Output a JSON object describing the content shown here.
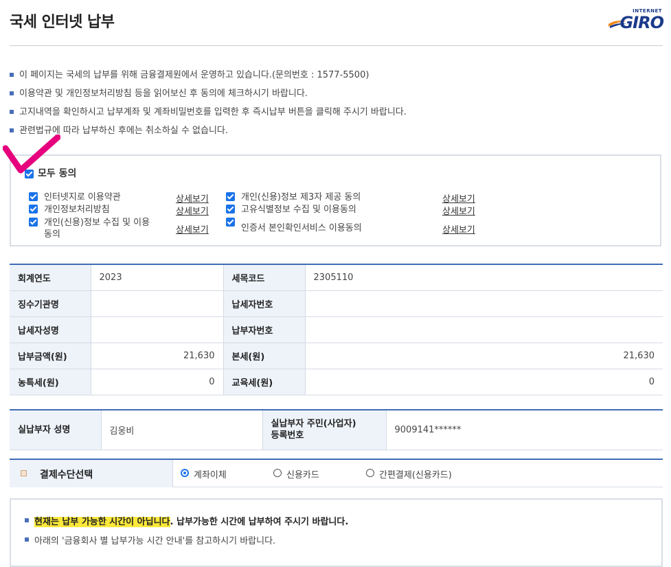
{
  "header": {
    "title": "국세 인터넷 납부",
    "logo_top": "INTERNET",
    "logo_main": "GIRO"
  },
  "notices": [
    "이 페이지는 국세의 납부를 위해 금융결제원에서 운영하고 있습니다.(문의번호 : 1577-5500)",
    "이용약관 및 개인정보처리방침 등을 읽어보신 후 동의에 체크하시기 바랍니다.",
    "고지내역을 확인하시고 납부계좌 및 계좌비밀번호를 입력한 후 즉시납부 버튼을 클릭해 주시기 바랍니다.",
    "관련법규에 따라 납부하신 후에는 취소하실 수 없습니다."
  ],
  "agreement": {
    "all_label": "모두 동의",
    "detail_label": "상세보기",
    "terms": [
      "인터넷지로 이용약관",
      "개인정보처리방침",
      "개인(신용)정보 수집 및 이용",
      "동의",
      "개인(신용)정보 제3자 제공 동의",
      "고유식별정보 수집 및 이용동의",
      "인증서 본인확인서비스 이용동의"
    ]
  },
  "info": {
    "labels": [
      "회계연도",
      "세목코드",
      "징수기관명",
      "납세자번호",
      "납세자성명",
      "납부자번호",
      "납부금액(원)",
      "본세(원)",
      "농특세(원)",
      "교육세(원)"
    ],
    "values": {
      "fiscal_year": "2023",
      "tax_code": "2305110",
      "payment_amount": "21,630",
      "base_tax": "21,630",
      "rural_tax": "0",
      "edu_tax": "0"
    }
  },
  "payer": {
    "name_label": "실납부자 성명",
    "name": "김웅비",
    "id_label_1": "실납부자 주민(사업자)",
    "id_label_2": "등록번호",
    "id_value": "9009141******"
  },
  "payment_method": {
    "title": "결제수단선택",
    "options": [
      "계좌이체",
      "신용카드",
      "간편결제(신용카드)"
    ],
    "selected": "계좌이체"
  },
  "warning": {
    "highlight": "현재는 납부 가능한 시간이 아닙니다",
    "rest": ". 납부가능한 시간에 납부하여 주시기 바랍니다.",
    "note": "아래의 '금융회사 별 납부가능 시간 안내'를 참고하시기 바랍니다."
  },
  "colors": {
    "accent": "#3f6cb8",
    "highlight": "#fbe83a",
    "checkmark": "#e6007e",
    "checkbox": "#1a73e8"
  }
}
